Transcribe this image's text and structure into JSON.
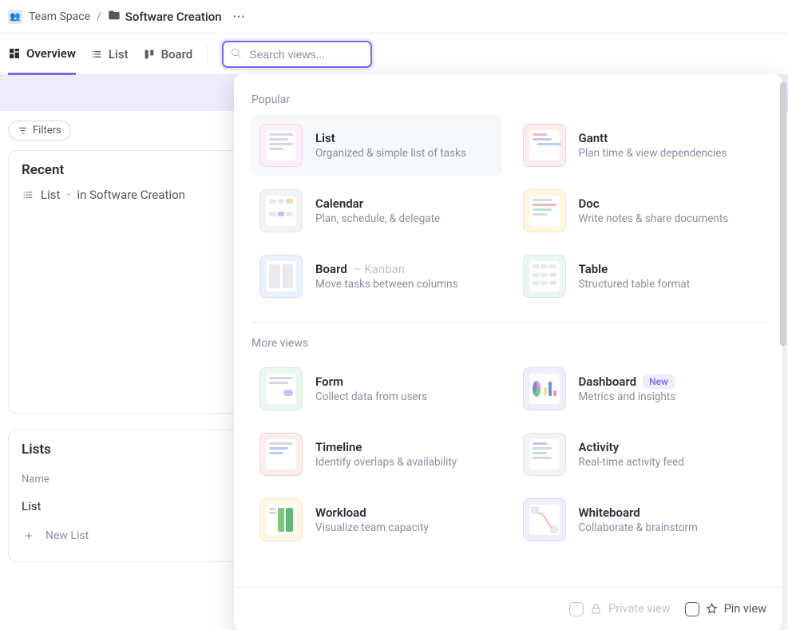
{
  "breadcrumb": {
    "team": "Team Space",
    "folder": "Software Creation"
  },
  "tabs": {
    "overview": "Overview",
    "list": "List",
    "board": "Board"
  },
  "search": {
    "placeholder": "Search views..."
  },
  "filters": {
    "button": "Filters"
  },
  "recent": {
    "heading": "Recent",
    "item_name": "List",
    "item_location": "in Software Creation"
  },
  "lists": {
    "heading": "Lists",
    "col_name": "Name",
    "row0": "List",
    "new_list": "New List"
  },
  "popover": {
    "section_popular": "Popular",
    "section_more": "More views",
    "views": {
      "list": {
        "title": "List",
        "sub": "Organized & simple list of tasks"
      },
      "gantt": {
        "title": "Gantt",
        "sub": "Plan time & view dependencies"
      },
      "calendar": {
        "title": "Calendar",
        "sub": "Plan, schedule, & delegate"
      },
      "doc": {
        "title": "Doc",
        "sub": "Write notes & share documents"
      },
      "board": {
        "title": "Board",
        "suffix": "– Kanban",
        "sub": "Move tasks between columns"
      },
      "table": {
        "title": "Table",
        "sub": "Structured table format"
      },
      "form": {
        "title": "Form",
        "sub": "Collect data from users"
      },
      "dashboard": {
        "title": "Dashboard",
        "badge": "New",
        "sub": "Metrics and insights"
      },
      "timeline": {
        "title": "Timeline",
        "sub": "Identify overlaps & availability"
      },
      "activity": {
        "title": "Activity",
        "sub": "Real-time activity feed"
      },
      "workload": {
        "title": "Workload",
        "sub": "Visualize team capacity"
      },
      "whiteboard": {
        "title": "Whiteboard",
        "sub": "Collaborate & brainstorm"
      }
    },
    "footer": {
      "private": "Private view",
      "pin": "Pin view"
    }
  }
}
